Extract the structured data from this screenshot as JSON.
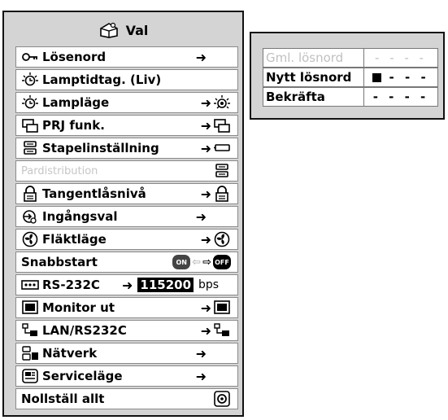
{
  "menu": {
    "title": "Val",
    "title_icon": "menu-options-icon",
    "items": [
      {
        "name": "password",
        "label": "Lösenord",
        "icon": "key-icon",
        "arrow": "➜",
        "right_icon": "",
        "enabled": true
      },
      {
        "name": "lamp-timer",
        "label": "Lamptidtag. (Liv)",
        "icon": "lamp-icon",
        "arrow": "",
        "right_icon": "",
        "enabled": true
      },
      {
        "name": "lamp-mode",
        "label": "Lampläge",
        "icon": "lamp-icon",
        "arrow": "➜",
        "right_icon": "lamp-mode-icon",
        "enabled": true
      },
      {
        "name": "prj-function",
        "label": "PRJ funk.",
        "icon": "projector-icon",
        "arrow": "➜",
        "right_icon": "projector-icon",
        "enabled": true
      },
      {
        "name": "stack-setting",
        "label": "Stapelinställning",
        "icon": "stack-icon",
        "arrow": "➜",
        "right_icon": "stack-off-icon",
        "enabled": true
      },
      {
        "name": "pair-distribution",
        "label": "Pardistribution",
        "icon": "",
        "arrow": "",
        "right_icon": "stack-icon",
        "enabled": false
      },
      {
        "name": "key-lock-level",
        "label": "Tangentlåsnivå",
        "icon": "padlock-icon",
        "arrow": "➜",
        "right_icon": "padlock-icon",
        "enabled": true
      },
      {
        "name": "input-select",
        "label": "Ingångsval",
        "icon": "input-icon",
        "arrow": "➜",
        "right_icon": "",
        "enabled": true
      },
      {
        "name": "fan-mode",
        "label": "Fläktläge",
        "icon": "fan-icon",
        "arrow": "➜",
        "right_icon": "fan-icon",
        "enabled": true
      },
      {
        "name": "quick-start",
        "label": "Snabbstart",
        "icon": "",
        "arrow": "",
        "right_icon": "",
        "enabled": true,
        "toggle": {
          "on": "ON",
          "off": "OFF"
        }
      },
      {
        "name": "rs232c",
        "label": "RS-232C",
        "icon": "serial-port-icon",
        "arrow": "➜",
        "right_icon": "",
        "enabled": true,
        "value": "115200",
        "unit": "bps"
      },
      {
        "name": "monitor-out",
        "label": "Monitor ut",
        "icon": "monitor-icon",
        "arrow": "➜",
        "right_icon": "monitor-icon",
        "enabled": true
      },
      {
        "name": "lan-rs232c",
        "label": "LAN/RS232C",
        "icon": "lan-icon",
        "arrow": "➜",
        "right_icon": "lan-icon",
        "enabled": true
      },
      {
        "name": "network",
        "label": "Nätverk",
        "icon": "network-icon",
        "arrow": "➜",
        "right_icon": "",
        "enabled": true
      },
      {
        "name": "service-mode",
        "label": "Serviceläge",
        "icon": "service-icon",
        "arrow": "➜",
        "right_icon": "",
        "enabled": true
      },
      {
        "name": "reset-all",
        "label": "Nollställ allt",
        "icon": "",
        "arrow": "",
        "right_icon": "reset-icon",
        "enabled": true
      }
    ]
  },
  "password_panel": {
    "rows": [
      {
        "label": "Gml. lösnord",
        "value": "- - - -",
        "enabled": false,
        "cursor": false
      },
      {
        "label": "Nytt lösnord",
        "value": "- - -",
        "enabled": true,
        "cursor": true
      },
      {
        "label": "Bekräfta",
        "value": "- - - -",
        "enabled": true,
        "cursor": false
      }
    ]
  },
  "colors": {
    "panel": "#d4d4d4",
    "row": "#ffffff",
    "disabled_text": "#c6c6c6"
  }
}
